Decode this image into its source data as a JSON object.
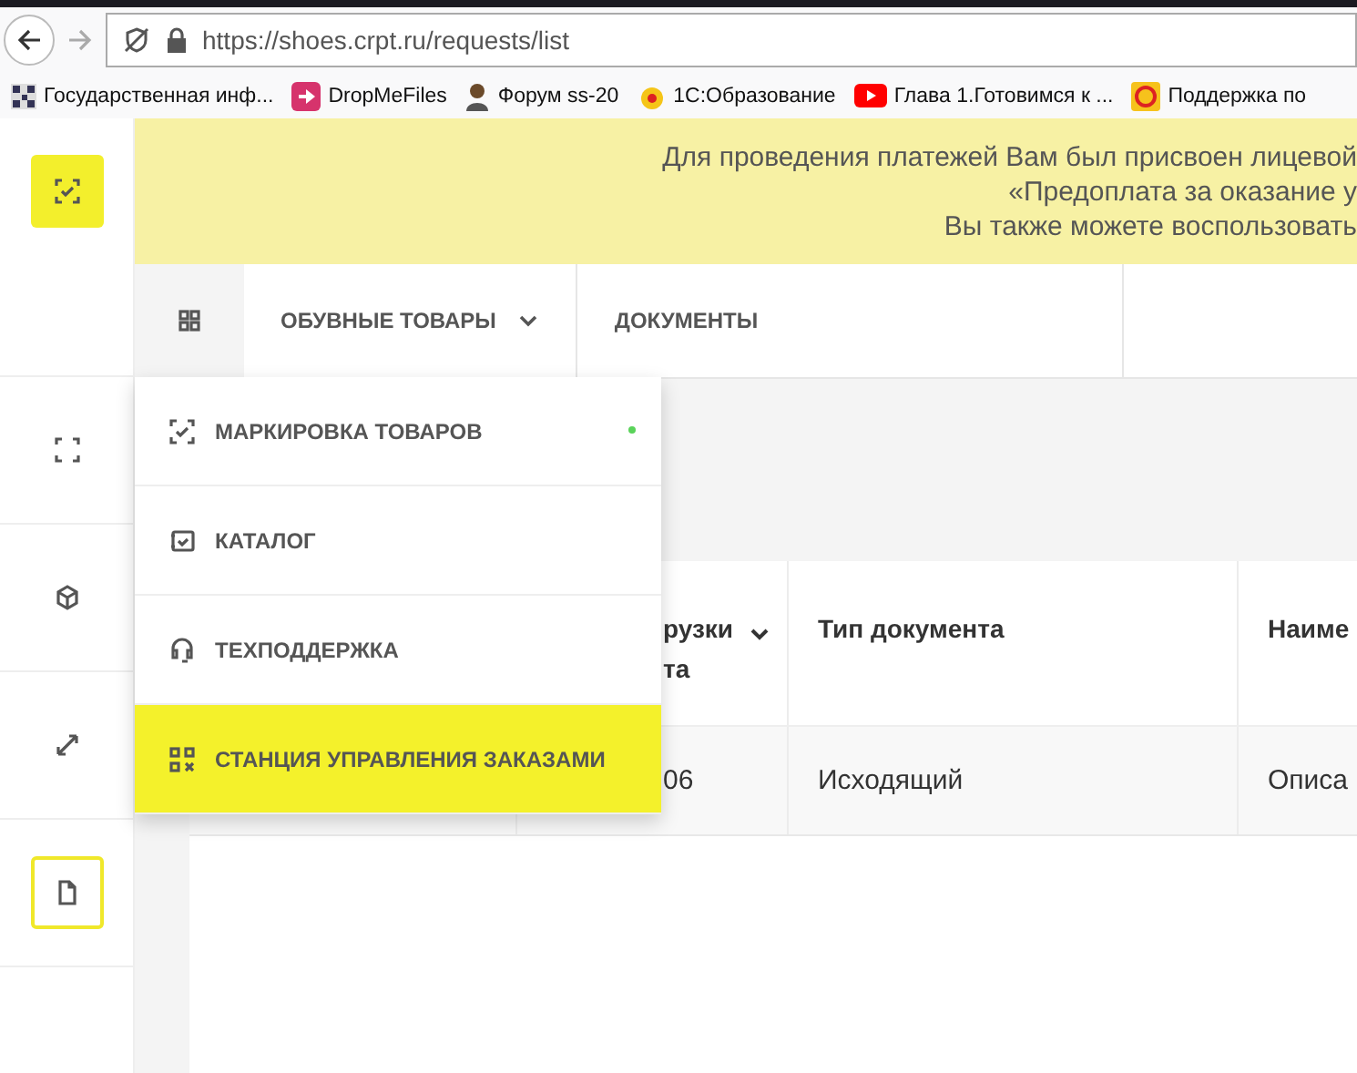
{
  "browser": {
    "url": "https://shoes.crpt.ru/requests/list",
    "bookmarks": [
      {
        "label": "Государственная инф..."
      },
      {
        "label": "DropMeFiles"
      },
      {
        "label": "Форум ss-20"
      },
      {
        "label": "1С:Образование"
      },
      {
        "label": "Глава 1.Готовимся к ..."
      },
      {
        "label": "Поддержка по"
      }
    ]
  },
  "sidebar": {
    "items": [
      {
        "selected": false
      },
      {
        "selected": false
      },
      {
        "selected": false
      },
      {
        "selected": true
      }
    ]
  },
  "notice": {
    "lines": [
      "Для проведения платежей Вам был присвоен лицевой",
      "«Предоплата за оказание у",
      "Вы также можете воспользовать"
    ]
  },
  "nav": {
    "tabs": [
      {
        "label": "ОБУВНЫЕ ТОВАРЫ",
        "has_caret": true
      },
      {
        "label": "ДОКУМЕНТЫ",
        "has_caret": false
      }
    ]
  },
  "menu": {
    "items": [
      {
        "label": "МАРКИРОВКА ТОВАРОВ",
        "notification": true,
        "selected": false
      },
      {
        "label": "КАТАЛОГ",
        "notification": false,
        "selected": false
      },
      {
        "label": "ТЕХПОДДЕРЖКА",
        "notification": false,
        "selected": false
      },
      {
        "label": "СТАНЦИЯ УПРАВЛЕНИЯ ЗАКАЗАМИ",
        "notification": false,
        "selected": true
      }
    ]
  },
  "table": {
    "columns": [
      {
        "lines": [
          "рузки",
          "та"
        ],
        "sortable": true
      },
      {
        "lines": [
          "Тип документа"
        ],
        "sortable": false
      },
      {
        "lines": [
          "Наиме"
        ],
        "sortable": false
      }
    ],
    "rows": [
      [
        "06",
        "Исходящий",
        "Описа"
      ]
    ]
  }
}
